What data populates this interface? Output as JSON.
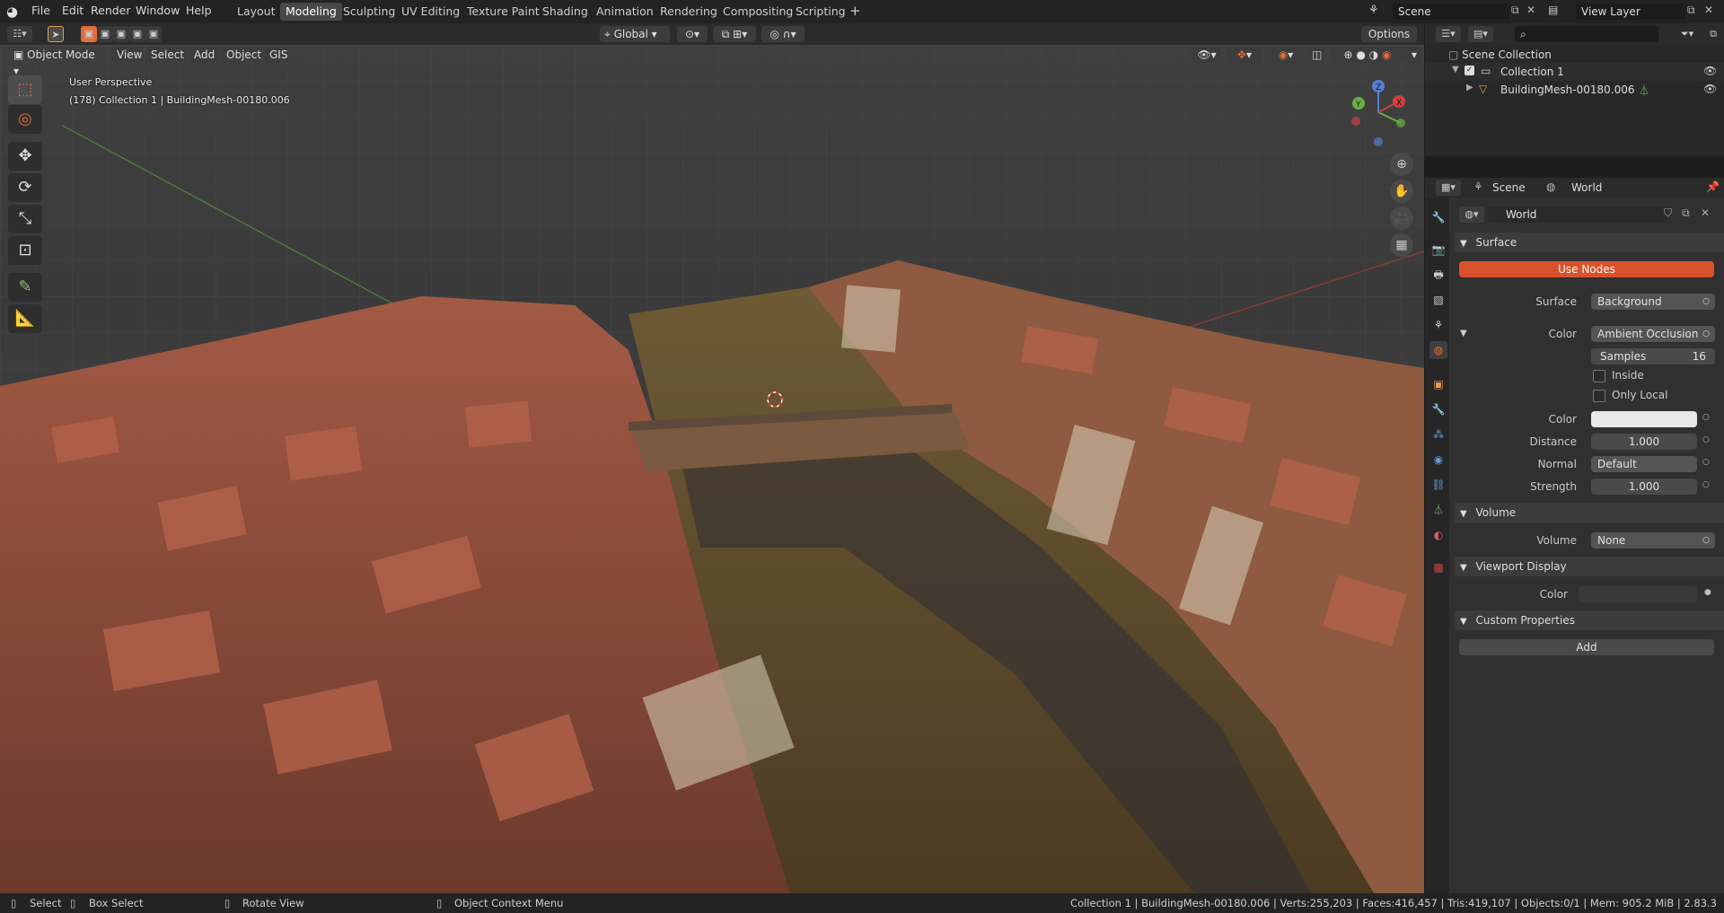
{
  "menu": {
    "file": "File",
    "edit": "Edit",
    "render": "Render",
    "window": "Window",
    "help": "Help"
  },
  "workspaces": [
    "Layout",
    "Modeling",
    "Sculpting",
    "UV Editing",
    "Texture Paint",
    "Shading",
    "Animation",
    "Rendering",
    "Compositing",
    "Scripting"
  ],
  "active_workspace": "Modeling",
  "scene_name": "Scene",
  "view_layer": "View Layer",
  "transform_orientation": "Global",
  "options_label": "Options",
  "viewport_header": {
    "mode": "Object Mode",
    "view": "View",
    "select": "Select",
    "add": "Add",
    "object": "Object",
    "gis": "GIS"
  },
  "viewport_overlay": {
    "perspective": "User Perspective",
    "info": "(178) Collection 1 | BuildingMesh-00180.006"
  },
  "gizmo": {
    "x": "X",
    "y": "Y",
    "z": "Z"
  },
  "outliner": {
    "root": "Scene Collection",
    "collection": "Collection 1",
    "object": "BuildingMesh-00180.006"
  },
  "props_header": {
    "scene": "Scene",
    "world": "World"
  },
  "world_name": "World",
  "surface": {
    "title": "Surface",
    "use_nodes": "Use Nodes",
    "surface_label": "Surface",
    "surface_value": "Background",
    "color_label": "Color",
    "color_value": "Ambient Occlusion",
    "samples_label": "Samples",
    "samples_value": "16",
    "inside": "Inside",
    "only_local": "Only Local",
    "color2_label": "Color",
    "distance_label": "Distance",
    "distance_value": "1.000",
    "normal_label": "Normal",
    "normal_value": "Default",
    "strength_label": "Strength",
    "strength_value": "1.000"
  },
  "volume": {
    "title": "Volume",
    "label": "Volume",
    "value": "None"
  },
  "viewport_display": {
    "title": "Viewport Display",
    "color_label": "Color"
  },
  "custom_properties": {
    "title": "Custom Properties",
    "add": "Add"
  },
  "statusbar": {
    "select": "Select",
    "box_select": "Box Select",
    "rotate_view": "Rotate View",
    "context_menu": "Object Context Menu",
    "stats": "Collection 1 | BuildingMesh-00180.006 | Verts:255,203 | Faces:416,457 | Tris:419,107 | Objects:0/1 | Mem: 905.2 MiB | 2.83.3"
  },
  "colors": {
    "accent": "#e06c3a",
    "use_nodes": "#d9512c",
    "background": "#303030",
    "water": "#5c4a2a",
    "roof": "#9c4e38"
  }
}
